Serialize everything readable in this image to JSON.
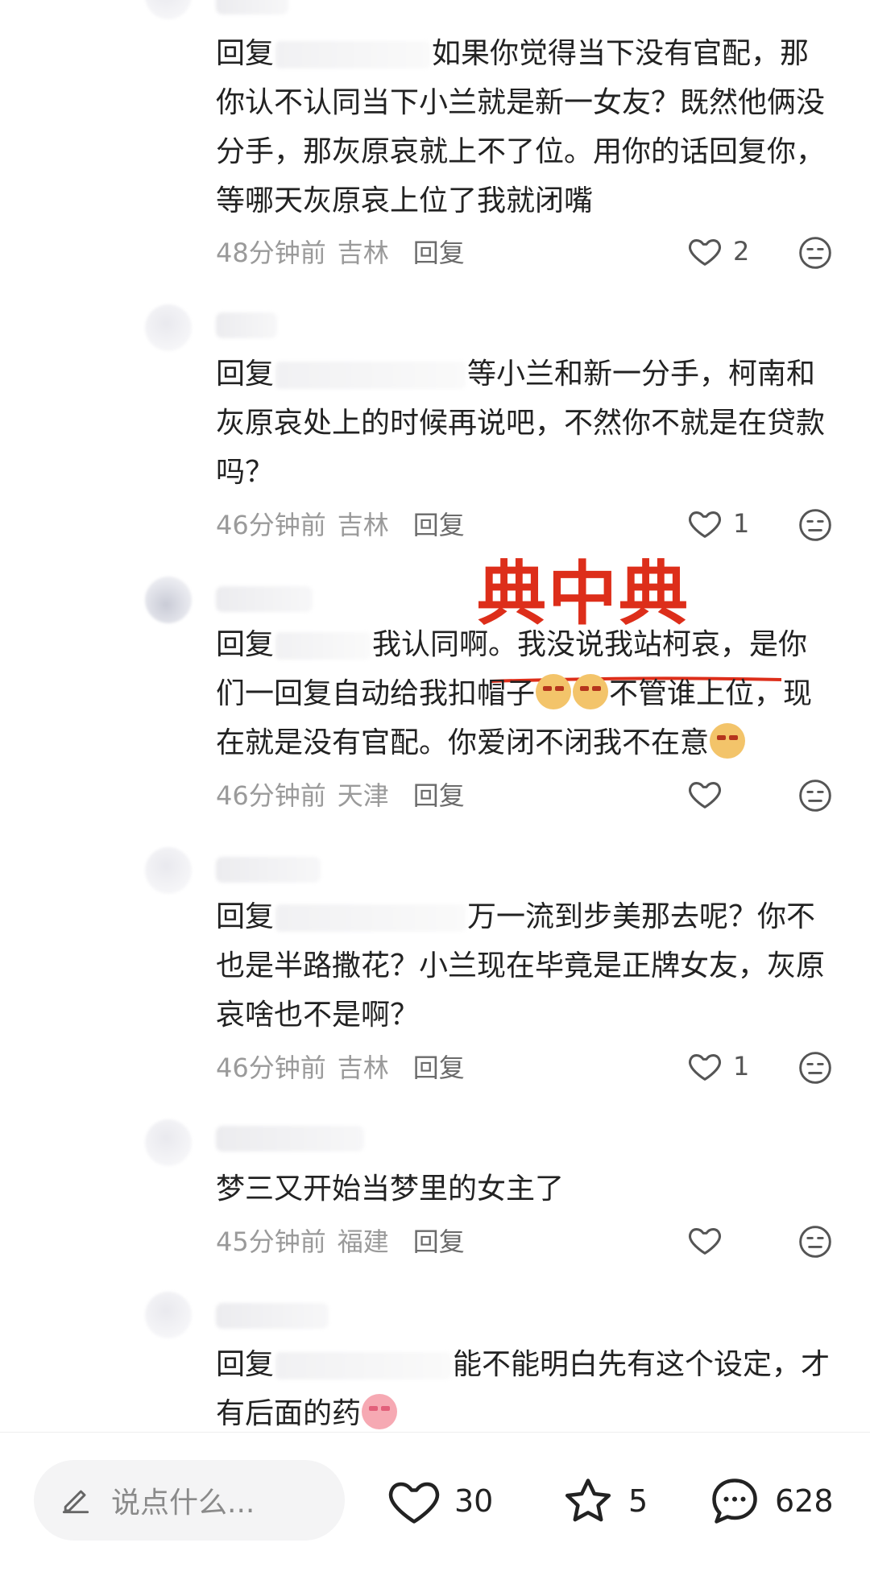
{
  "comments": [
    {
      "reply_prefix": "回复",
      "body": "如果你觉得当下没有官配，那你认不认同当下小兰就是新一女友？既然他俩没分手，那灰原哀就上不了位。用你的话回复你，等哪天灰原哀上位了我就闭嘴",
      "time": "48分钟前",
      "location": "吉林",
      "reply_label": "回复",
      "likes": "2"
    },
    {
      "reply_prefix": "回复",
      "body": "等小兰和新一分手，柯南和灰原哀处上的时候再说吧，不然你不就是在贷款吗？",
      "time": "46分钟前",
      "location": "吉林",
      "reply_label": "回复",
      "likes": "1"
    },
    {
      "reply_prefix": "回复",
      "body_part1": "我认同啊。我没说我站柯哀，是你们一回复自动给我扣帽子",
      "body_part2": "不管谁上位，现在就是没有官配。你爱闭不闭我不在意",
      "time": "46分钟前",
      "location": "天津",
      "reply_label": "回复",
      "likes": ""
    },
    {
      "reply_prefix": "回复",
      "body": "万一流到步美那去呢？你不也是半路撒花？小兰现在毕竟是正牌女友，灰原哀啥也不是啊？",
      "time": "46分钟前",
      "location": "吉林",
      "reply_label": "回复",
      "likes": "1"
    },
    {
      "body": "梦三又开始当梦里的女主了",
      "time": "45分钟前",
      "location": "福建",
      "reply_label": "回复",
      "likes": ""
    },
    {
      "reply_prefix": "回复",
      "body": "能不能明白先有这个设定，才有后面的药",
      "time": "",
      "location": "",
      "reply_label": "",
      "likes": ""
    }
  ],
  "overlay": {
    "title": "典中典",
    "color": "#dd2e1a"
  },
  "bottom_bar": {
    "input_placeholder": "说点什么...",
    "likes": "30",
    "favorites": "5",
    "comments": "628"
  },
  "icons": [
    "heart-icon",
    "neutral-face-icon",
    "pencil-icon",
    "star-icon",
    "chat-bubble-icon"
  ]
}
